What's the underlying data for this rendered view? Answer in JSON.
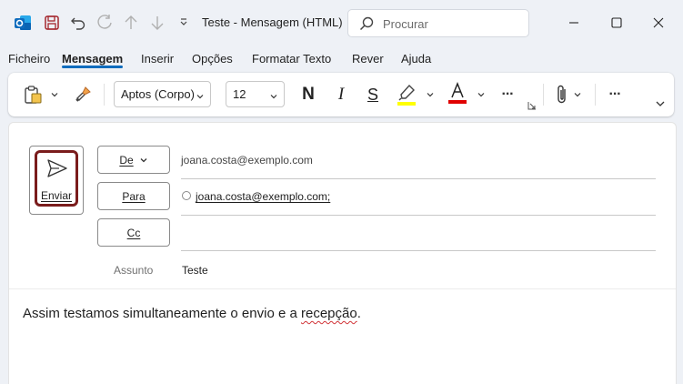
{
  "titlebar": {
    "app_icon": "outlook-icon",
    "window_title": "Teste  -  Mensagem (HTML)",
    "quick_access": [
      "save-icon",
      "undo-icon",
      "redo-icon",
      "up-arrow-icon",
      "down-arrow-icon",
      "customize-chevron-icon"
    ]
  },
  "search": {
    "placeholder": "Procurar"
  },
  "menu": {
    "items": [
      "Ficheiro",
      "Mensagem",
      "Inserir",
      "Opções",
      "Formatar Texto",
      "Rever",
      "Ajuda"
    ],
    "active": "Mensagem"
  },
  "ribbon": {
    "font_name": "Aptos (Corpo)",
    "font_size": "12",
    "bold_label": "N",
    "italic_label": "I",
    "underline_label": "S",
    "font_color_label": "A",
    "highlight_color": "#ffff00",
    "font_color": "#e00000",
    "more_label": "···"
  },
  "compose": {
    "send_label": "Enviar",
    "from_label": "De",
    "from_value": "joana.costa@exemplo.com",
    "to_label": "Para",
    "to_value": "joana.costa@exemplo.com;",
    "cc_label": "Cc",
    "cc_value": "",
    "subject_label": "Assunto",
    "subject_value": "Teste",
    "body_before": "Assim testamos simultaneamente o envio e a ",
    "body_misspelled": "recepção",
    "body_after": "."
  },
  "colors": {
    "accent": "#0f6cbd",
    "send_border": "#7a1c1c",
    "background": "#eef1f6"
  }
}
